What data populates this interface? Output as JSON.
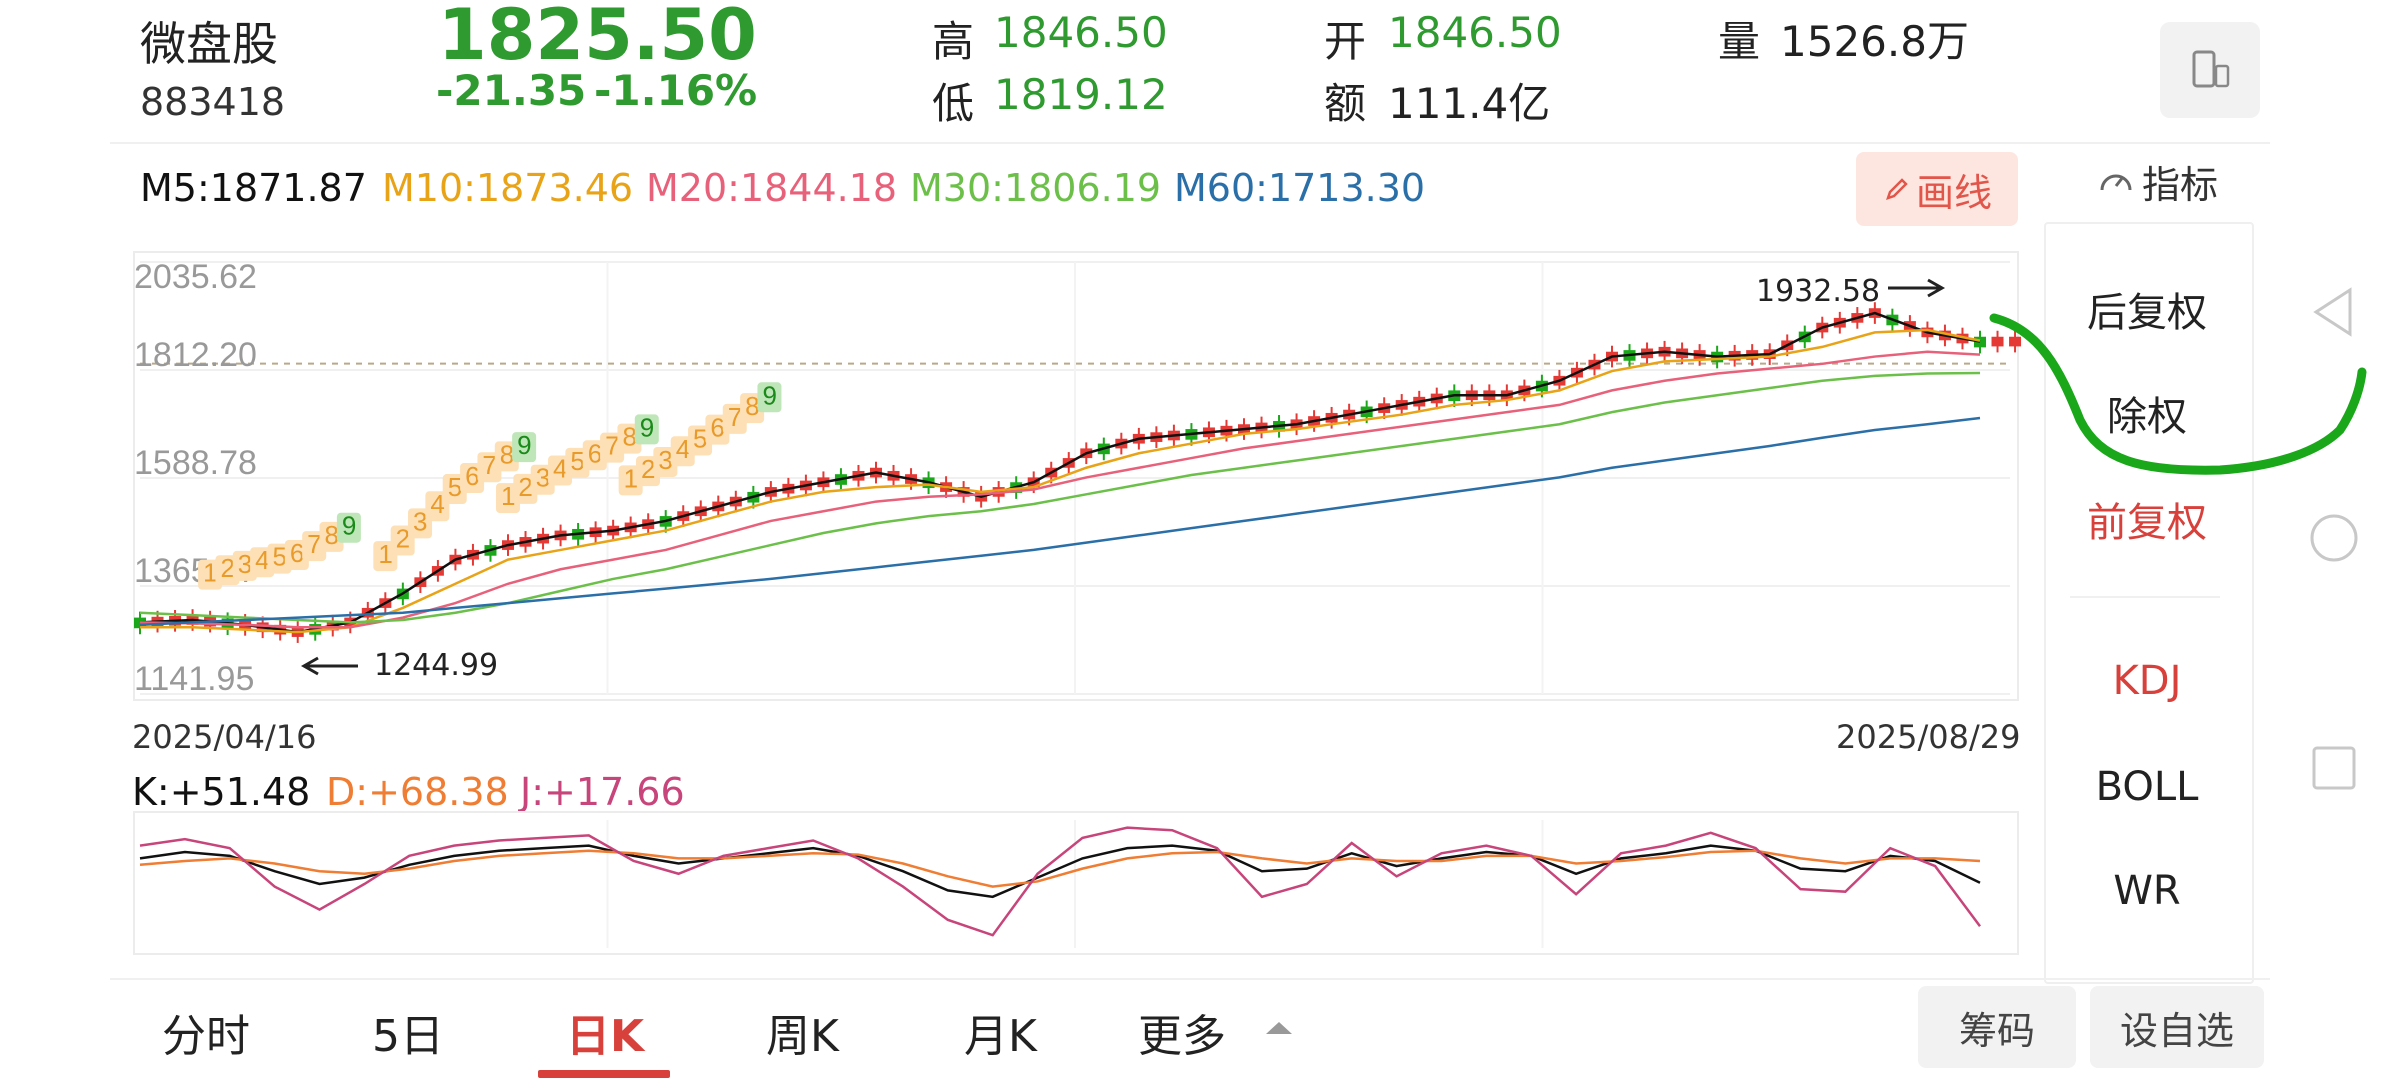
{
  "stock": {
    "name": "微盘股",
    "code": "883418",
    "price": "1825.50",
    "change": "-21.35",
    "change_pct": "-1.16%",
    "high_label": "高",
    "high": "1846.50",
    "low_label": "低",
    "low": "1819.12",
    "open_label": "开",
    "open": "1846.50",
    "amount_label": "额",
    "amount": "111.4亿",
    "volume_label": "量",
    "volume": "1526.8万"
  },
  "ma": {
    "m5": "M5:1871.87",
    "m10": "M10:1873.46",
    "m20": "M20:1844.18",
    "m30": "M30:1806.19",
    "m60": "M60:1713.30"
  },
  "toolbar": {
    "draw_label": "画线",
    "indicator_label": "指标"
  },
  "chart_data": {
    "type": "line",
    "y_ticks": [
      "2035.62",
      "1812.20",
      "1588.78",
      "1365.37",
      "1141.95"
    ],
    "ylim": [
      1141.95,
      2035.62
    ],
    "start_date": "2025/04/16",
    "end_date": "2025/08/29",
    "max_annotation": "1932.58",
    "min_annotation": "1244.99",
    "series": [
      {
        "name": "M5",
        "color": "#111111",
        "values": [
          1290,
          1295,
          1285,
          1270,
          1290,
          1350,
          1420,
          1450,
          1470,
          1480,
          1500,
          1530,
          1560,
          1580,
          1600,
          1580,
          1550,
          1580,
          1640,
          1670,
          1680,
          1690,
          1700,
          1720,
          1740,
          1760,
          1760,
          1790,
          1840,
          1850,
          1840,
          1845,
          1900,
          1930,
          1890,
          1871
        ]
      },
      {
        "name": "M10",
        "color": "#e8a317",
        "values": [
          1280,
          1280,
          1275,
          1270,
          1280,
          1320,
          1370,
          1420,
          1440,
          1460,
          1480,
          1510,
          1540,
          1560,
          1570,
          1575,
          1560,
          1570,
          1610,
          1640,
          1660,
          1680,
          1690,
          1705,
          1720,
          1740,
          1750,
          1770,
          1810,
          1830,
          1835,
          1840,
          1860,
          1890,
          1895,
          1873
        ]
      },
      {
        "name": "M20",
        "color": "#e8617a",
        "values": [
          1290,
          1288,
          1285,
          1280,
          1280,
          1300,
          1330,
          1370,
          1400,
          1420,
          1440,
          1470,
          1500,
          1520,
          1540,
          1550,
          1555,
          1565,
          1590,
          1610,
          1630,
          1650,
          1665,
          1680,
          1695,
          1710,
          1725,
          1740,
          1770,
          1790,
          1805,
          1815,
          1825,
          1840,
          1850,
          1844
        ]
      },
      {
        "name": "M30",
        "color": "#6cc04a",
        "values": [
          1310,
          1305,
          1300,
          1295,
          1290,
          1295,
          1310,
          1330,
          1355,
          1380,
          1400,
          1425,
          1450,
          1475,
          1495,
          1510,
          1520,
          1535,
          1555,
          1575,
          1595,
          1610,
          1625,
          1640,
          1655,
          1670,
          1685,
          1700,
          1725,
          1745,
          1760,
          1775,
          1790,
          1800,
          1805,
          1806
        ]
      },
      {
        "name": "M60",
        "color": "#2b6fa8",
        "values": [
          1285,
          1290,
          1295,
          1300,
          1305,
          1310,
          1320,
          1330,
          1340,
          1350,
          1360,
          1370,
          1380,
          1392,
          1404,
          1416,
          1428,
          1440,
          1455,
          1470,
          1485,
          1500,
          1515,
          1530,
          1545,
          1560,
          1575,
          1590,
          1610,
          1625,
          1640,
          1655,
          1672,
          1688,
          1700,
          1713
        ]
      }
    ]
  },
  "kdj": {
    "k": "K:+51.48",
    "d": "D:+68.38",
    "j": "J:+17.66",
    "series": {
      "K": [
        70,
        75,
        72,
        60,
        50,
        55,
        65,
        72,
        76,
        78,
        80,
        72,
        66,
        70,
        74,
        78,
        72,
        60,
        45,
        40,
        55,
        70,
        78,
        80,
        76,
        60,
        62,
        74,
        64,
        70,
        75,
        72,
        58,
        70,
        74,
        80,
        76,
        62,
        60,
        72,
        68,
        51
      ],
      "D": [
        65,
        68,
        70,
        66,
        60,
        58,
        62,
        68,
        72,
        74,
        76,
        74,
        70,
        70,
        72,
        74,
        73,
        66,
        56,
        48,
        52,
        62,
        70,
        74,
        75,
        70,
        66,
        70,
        68,
        68,
        72,
        72,
        66,
        68,
        71,
        75,
        76,
        70,
        66,
        70,
        70,
        68
      ],
      "J": [
        80,
        85,
        78,
        48,
        30,
        50,
        72,
        80,
        84,
        86,
        88,
        68,
        58,
        72,
        78,
        84,
        70,
        48,
        22,
        10,
        58,
        86,
        94,
        92,
        78,
        40,
        50,
        82,
        56,
        74,
        80,
        72,
        42,
        74,
        80,
        90,
        78,
        46,
        44,
        78,
        64,
        17
      ]
    }
  },
  "side_menu": {
    "item1": "后复权",
    "item2": "除权",
    "item3": "前复权",
    "item4": "KDJ",
    "item5": "BOLL",
    "item6": "WR"
  },
  "tabs": {
    "t1": "分时",
    "t2": "5日",
    "t3": "日K",
    "t4": "周K",
    "t5": "月K",
    "t6": "更多"
  },
  "buttons": {
    "chips": "筹码",
    "watchlist": "设自选"
  }
}
